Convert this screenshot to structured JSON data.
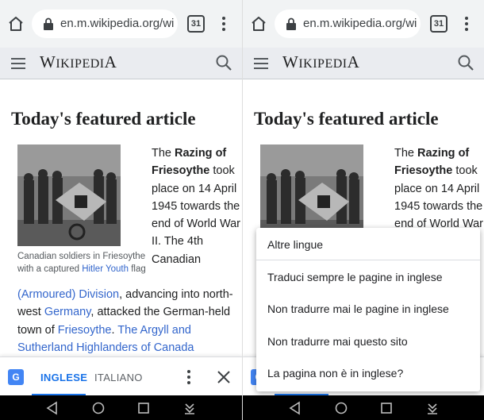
{
  "browser": {
    "url": "en.m.wikipedia.org/wik",
    "tab_count": "31"
  },
  "wiki": {
    "logo_text": "Wikipedia"
  },
  "article": {
    "section_title": "Today's featured article",
    "caption_pre": "Canadian soldiers in Friesoythe with a captured ",
    "caption_link": "Hitler Youth",
    "caption_post": " flag",
    "text_the": "The ",
    "link_razing": "Razing of Friesoythe",
    "text_1": " took place on 14 April 1945 towards the end of World War II. The ",
    "link_4th": "4th Canadian (Armoured) Division",
    "text_2": ", advancing into north-west ",
    "link_germany": "Germany",
    "text_3": ", attacked the German-held town of ",
    "link_friesoythe": "Friesoythe",
    "text_4": ". ",
    "link_argyll": "The Argyll and Sutherland Highlanders of Canada"
  },
  "translate_bar": {
    "source_lang": "INGLESE",
    "target_lang": "ITALIANO"
  },
  "popup_menu": {
    "items": [
      "Altre lingue",
      "Traduci sempre le pagine in inglese",
      "Non tradurre mai le pagine in inglese",
      "Non tradurre mai questo sito",
      "La pagina non è in inglese?"
    ]
  },
  "colors": {
    "link": "#3366cc",
    "accent": "#1a73e8",
    "toolbar_bg": "#f1f3f4",
    "wiki_header_bg": "#eaecf0"
  }
}
